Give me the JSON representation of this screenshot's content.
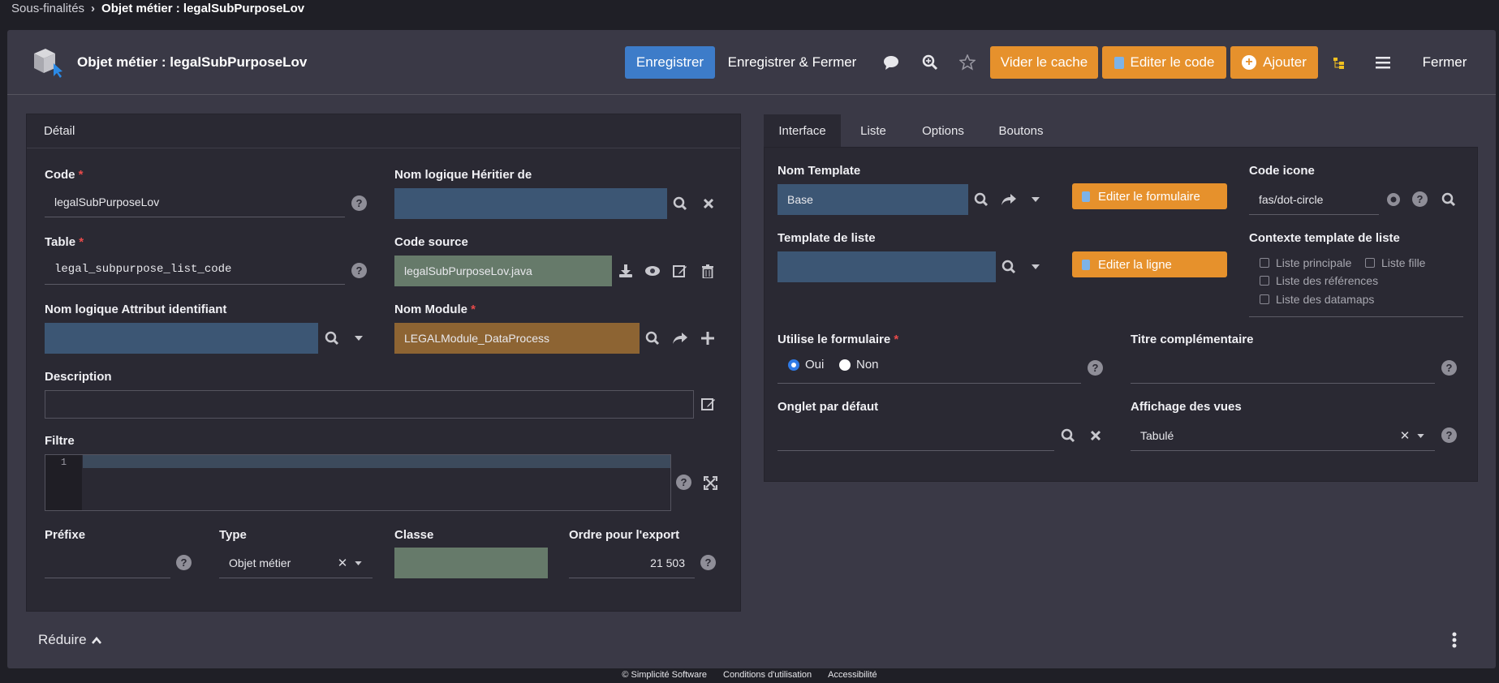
{
  "breadcrumb": {
    "parent": "Sous-finalités",
    "current": "Objet métier : legalSubPurposeLov"
  },
  "header": {
    "title": "Objet métier : legalSubPurposeLov",
    "save": "Enregistrer",
    "save_close": "Enregistrer & Fermer",
    "clear_cache": "Vider le cache",
    "edit_code": "Editer le code",
    "add": "Ajouter",
    "close": "Fermer"
  },
  "detail": {
    "heading": "Détail",
    "code_label": "Code",
    "code_value": "legalSubPurposeLov",
    "table_label": "Table",
    "table_value": "legal_subpurpose_list_code",
    "id_attr_label": "Nom logique Attribut identifiant",
    "id_attr_value": "",
    "inherit_label": "Nom logique Héritier de",
    "inherit_value": "",
    "source_label": "Code source",
    "source_value": "legalSubPurposeLov.java",
    "module_label": "Nom Module",
    "module_value": "LEGALModule_DataProcess",
    "desc_label": "Description",
    "desc_value": "",
    "filter_label": "Filtre",
    "filter_line": "1",
    "prefix_label": "Préfixe",
    "prefix_value": "",
    "type_label": "Type",
    "type_value": "Objet métier",
    "class_label": "Classe",
    "class_value": "",
    "export_label": "Ordre pour l'export",
    "export_value": "21 503"
  },
  "tabs": [
    "Interface",
    "Liste",
    "Options",
    "Boutons"
  ],
  "interface": {
    "template_label": "Nom Template",
    "template_value": "Base",
    "edit_form": "Editer le formulaire",
    "icon_label": "Code icone",
    "icon_value": "fas/dot-circle",
    "list_template_label": "Template de liste",
    "list_template_value": "",
    "edit_line": "Editer la ligne",
    "context_label": "Contexte template de liste",
    "ctx_main": "Liste principale",
    "ctx_child": "Liste fille",
    "ctx_refs": "Liste des références",
    "ctx_datamaps": "Liste des datamaps",
    "use_form_label": "Utilise le formulaire",
    "yes": "Oui",
    "no": "Non",
    "extra_title_label": "Titre complémentaire",
    "extra_title_value": "",
    "default_tab_label": "Onglet par défaut",
    "default_tab_value": "",
    "views_label": "Affichage des vues",
    "views_value": "Tabulé"
  },
  "collapse": "Réduire",
  "footer": [
    "© Simplicité Software",
    "Conditions d'utilisation",
    "Accessibilité"
  ]
}
